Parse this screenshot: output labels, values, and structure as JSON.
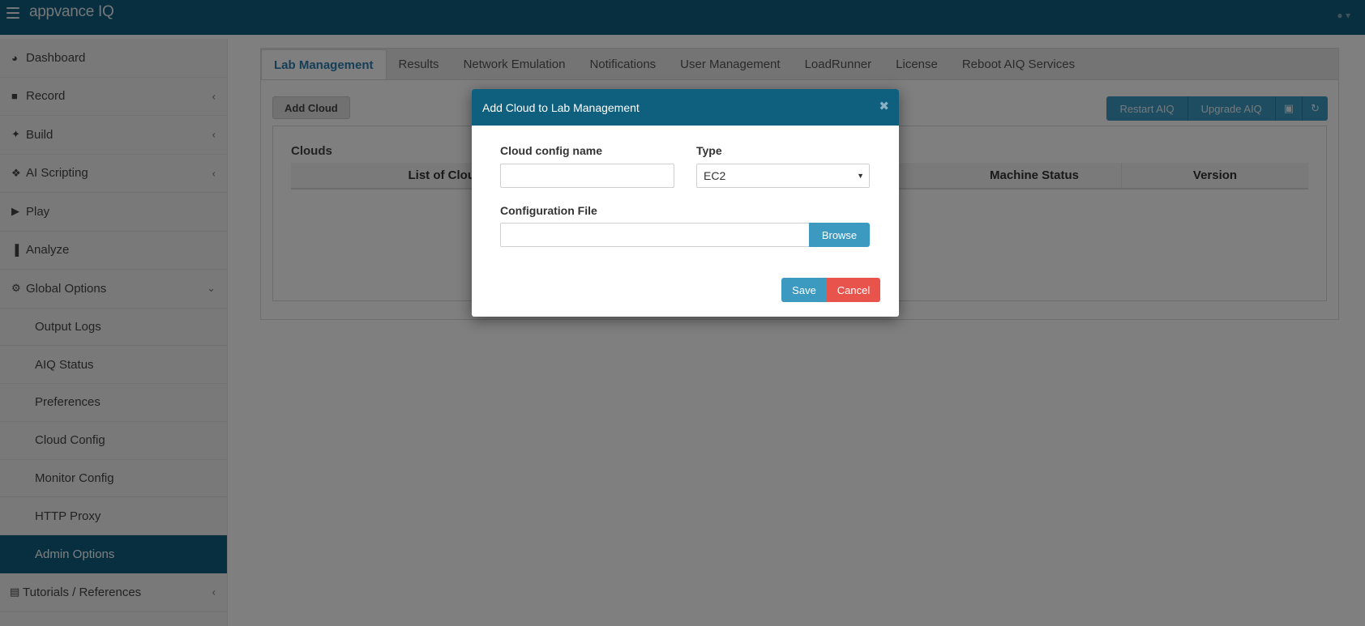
{
  "app": {
    "brand": "appvance IQ",
    "user_icon": "user-icon"
  },
  "sidebar": {
    "items": [
      {
        "label": "Dashboard",
        "icon": "dashboard-icon"
      },
      {
        "label": "Record",
        "icon": "video-camera-icon"
      },
      {
        "label": "Build",
        "icon": "wrench-icon"
      },
      {
        "label": "AI Scripting",
        "icon": "cubes-icon"
      },
      {
        "label": "Play",
        "icon": "play-icon"
      },
      {
        "label": "Analyze",
        "icon": "bar-chart-icon"
      },
      {
        "label": "Global Options",
        "icon": "gears-icon"
      }
    ],
    "sub_items": [
      {
        "label": "Output Logs"
      },
      {
        "label": "AIQ Status"
      },
      {
        "label": "Preferences"
      },
      {
        "label": "Cloud Config"
      },
      {
        "label": "Monitor Config"
      },
      {
        "label": "HTTP Proxy"
      },
      {
        "label": "Admin Options"
      }
    ],
    "bottom_item": {
      "label": "Tutorials / References",
      "icon": "book-icon"
    }
  },
  "main": {
    "tabs": [
      {
        "label": "Lab Management"
      },
      {
        "label": "Results"
      },
      {
        "label": "Network Emulation"
      },
      {
        "label": "Notifications"
      },
      {
        "label": "User Management"
      },
      {
        "label": "LoadRunner"
      },
      {
        "label": "License"
      },
      {
        "label": "Reboot AIQ Services"
      }
    ],
    "add_cloud_label": "Add Cloud",
    "restart_label": "Restart AIQ",
    "upgrade_label": "Upgrade AIQ",
    "panel_title": "Clouds",
    "table_headers": [
      "List of Clouds",
      "Machine Status",
      "Version"
    ]
  },
  "modal": {
    "title": "Add Cloud to Lab Management",
    "cloud_name_label": "Cloud config name",
    "cloud_name_value": "",
    "type_label": "Type",
    "type_value": "EC2",
    "config_file_label": "Configuration File",
    "config_file_value": "",
    "browse_label": "Browse",
    "save_label": "Save",
    "cancel_label": "Cancel"
  }
}
